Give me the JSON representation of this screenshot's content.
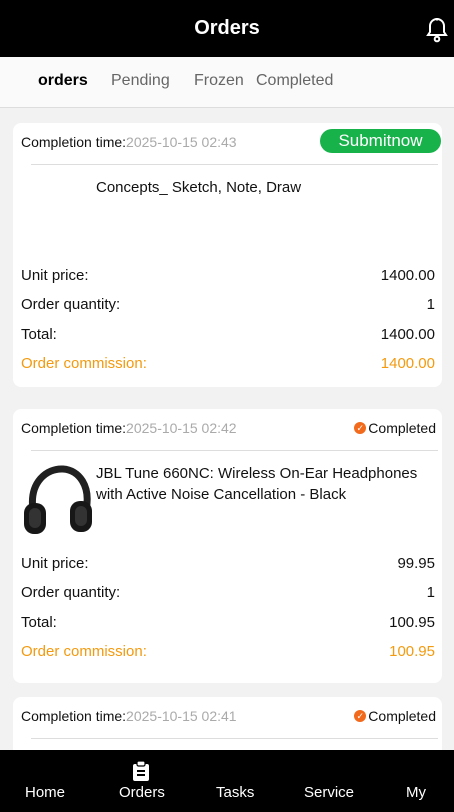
{
  "header": {
    "title": "Orders",
    "icon": "bell-icon"
  },
  "tabs": [
    {
      "label": "orders",
      "active": true
    },
    {
      "label": "Pending",
      "active": false
    },
    {
      "label": "Frozen",
      "active": false
    },
    {
      "label": "Completed",
      "active": false
    }
  ],
  "labels": {
    "completion": "Completion time:",
    "unit_price": "Unit price:",
    "quantity": "Order quantity:",
    "total": "Total:",
    "commission": "Order commission:"
  },
  "orders": [
    {
      "time": "2025-10-15 02:43",
      "action": "Submitnow",
      "product": "Concepts_ Sketch, Note, Draw",
      "unit_price": "1400.00",
      "quantity": "1",
      "total": "1400.00",
      "commission": "1400.00"
    },
    {
      "time": "2025-10-15 02:42",
      "status": "Completed",
      "product": "JBL Tune 660NC: Wireless On-Ear Headphones with Active Noise Cancellation - Black",
      "unit_price": "99.95",
      "quantity": "1",
      "total": "100.95",
      "commission": "100.95"
    },
    {
      "time": "2025-10-15 02:41",
      "status": "Completed"
    }
  ],
  "bottom_nav": [
    {
      "label": "Home"
    },
    {
      "label": "Orders",
      "active": true
    },
    {
      "label": "Tasks"
    },
    {
      "label": "Service"
    },
    {
      "label": "My"
    }
  ],
  "colors": {
    "header": "#000000",
    "submit": "#18b24b",
    "commission": "#f39a0f",
    "check": "#f26a1b"
  }
}
